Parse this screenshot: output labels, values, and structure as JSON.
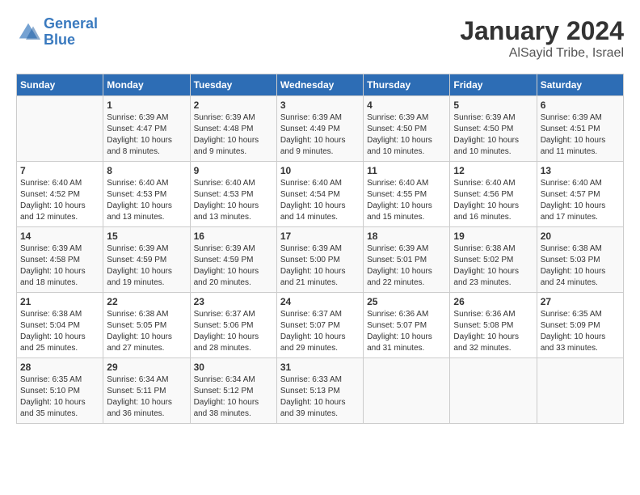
{
  "logo": {
    "line1": "General",
    "line2": "Blue"
  },
  "header": {
    "month": "January 2024",
    "location": "AlSayid Tribe, Israel"
  },
  "columns": [
    "Sunday",
    "Monday",
    "Tuesday",
    "Wednesday",
    "Thursday",
    "Friday",
    "Saturday"
  ],
  "weeks": [
    [
      {
        "day": "",
        "sunrise": "",
        "sunset": "",
        "daylight": ""
      },
      {
        "day": "1",
        "sunrise": "Sunrise: 6:39 AM",
        "sunset": "Sunset: 4:47 PM",
        "daylight": "Daylight: 10 hours and 8 minutes."
      },
      {
        "day": "2",
        "sunrise": "Sunrise: 6:39 AM",
        "sunset": "Sunset: 4:48 PM",
        "daylight": "Daylight: 10 hours and 9 minutes."
      },
      {
        "day": "3",
        "sunrise": "Sunrise: 6:39 AM",
        "sunset": "Sunset: 4:49 PM",
        "daylight": "Daylight: 10 hours and 9 minutes."
      },
      {
        "day": "4",
        "sunrise": "Sunrise: 6:39 AM",
        "sunset": "Sunset: 4:50 PM",
        "daylight": "Daylight: 10 hours and 10 minutes."
      },
      {
        "day": "5",
        "sunrise": "Sunrise: 6:39 AM",
        "sunset": "Sunset: 4:50 PM",
        "daylight": "Daylight: 10 hours and 10 minutes."
      },
      {
        "day": "6",
        "sunrise": "Sunrise: 6:39 AM",
        "sunset": "Sunset: 4:51 PM",
        "daylight": "Daylight: 10 hours and 11 minutes."
      }
    ],
    [
      {
        "day": "7",
        "sunrise": "Sunrise: 6:40 AM",
        "sunset": "Sunset: 4:52 PM",
        "daylight": "Daylight: 10 hours and 12 minutes."
      },
      {
        "day": "8",
        "sunrise": "Sunrise: 6:40 AM",
        "sunset": "Sunset: 4:53 PM",
        "daylight": "Daylight: 10 hours and 13 minutes."
      },
      {
        "day": "9",
        "sunrise": "Sunrise: 6:40 AM",
        "sunset": "Sunset: 4:53 PM",
        "daylight": "Daylight: 10 hours and 13 minutes."
      },
      {
        "day": "10",
        "sunrise": "Sunrise: 6:40 AM",
        "sunset": "Sunset: 4:54 PM",
        "daylight": "Daylight: 10 hours and 14 minutes."
      },
      {
        "day": "11",
        "sunrise": "Sunrise: 6:40 AM",
        "sunset": "Sunset: 4:55 PM",
        "daylight": "Daylight: 10 hours and 15 minutes."
      },
      {
        "day": "12",
        "sunrise": "Sunrise: 6:40 AM",
        "sunset": "Sunset: 4:56 PM",
        "daylight": "Daylight: 10 hours and 16 minutes."
      },
      {
        "day": "13",
        "sunrise": "Sunrise: 6:40 AM",
        "sunset": "Sunset: 4:57 PM",
        "daylight": "Daylight: 10 hours and 17 minutes."
      }
    ],
    [
      {
        "day": "14",
        "sunrise": "Sunrise: 6:39 AM",
        "sunset": "Sunset: 4:58 PM",
        "daylight": "Daylight: 10 hours and 18 minutes."
      },
      {
        "day": "15",
        "sunrise": "Sunrise: 6:39 AM",
        "sunset": "Sunset: 4:59 PM",
        "daylight": "Daylight: 10 hours and 19 minutes."
      },
      {
        "day": "16",
        "sunrise": "Sunrise: 6:39 AM",
        "sunset": "Sunset: 4:59 PM",
        "daylight": "Daylight: 10 hours and 20 minutes."
      },
      {
        "day": "17",
        "sunrise": "Sunrise: 6:39 AM",
        "sunset": "Sunset: 5:00 PM",
        "daylight": "Daylight: 10 hours and 21 minutes."
      },
      {
        "day": "18",
        "sunrise": "Sunrise: 6:39 AM",
        "sunset": "Sunset: 5:01 PM",
        "daylight": "Daylight: 10 hours and 22 minutes."
      },
      {
        "day": "19",
        "sunrise": "Sunrise: 6:38 AM",
        "sunset": "Sunset: 5:02 PM",
        "daylight": "Daylight: 10 hours and 23 minutes."
      },
      {
        "day": "20",
        "sunrise": "Sunrise: 6:38 AM",
        "sunset": "Sunset: 5:03 PM",
        "daylight": "Daylight: 10 hours and 24 minutes."
      }
    ],
    [
      {
        "day": "21",
        "sunrise": "Sunrise: 6:38 AM",
        "sunset": "Sunset: 5:04 PM",
        "daylight": "Daylight: 10 hours and 25 minutes."
      },
      {
        "day": "22",
        "sunrise": "Sunrise: 6:38 AM",
        "sunset": "Sunset: 5:05 PM",
        "daylight": "Daylight: 10 hours and 27 minutes."
      },
      {
        "day": "23",
        "sunrise": "Sunrise: 6:37 AM",
        "sunset": "Sunset: 5:06 PM",
        "daylight": "Daylight: 10 hours and 28 minutes."
      },
      {
        "day": "24",
        "sunrise": "Sunrise: 6:37 AM",
        "sunset": "Sunset: 5:07 PM",
        "daylight": "Daylight: 10 hours and 29 minutes."
      },
      {
        "day": "25",
        "sunrise": "Sunrise: 6:36 AM",
        "sunset": "Sunset: 5:07 PM",
        "daylight": "Daylight: 10 hours and 31 minutes."
      },
      {
        "day": "26",
        "sunrise": "Sunrise: 6:36 AM",
        "sunset": "Sunset: 5:08 PM",
        "daylight": "Daylight: 10 hours and 32 minutes."
      },
      {
        "day": "27",
        "sunrise": "Sunrise: 6:35 AM",
        "sunset": "Sunset: 5:09 PM",
        "daylight": "Daylight: 10 hours and 33 minutes."
      }
    ],
    [
      {
        "day": "28",
        "sunrise": "Sunrise: 6:35 AM",
        "sunset": "Sunset: 5:10 PM",
        "daylight": "Daylight: 10 hours and 35 minutes."
      },
      {
        "day": "29",
        "sunrise": "Sunrise: 6:34 AM",
        "sunset": "Sunset: 5:11 PM",
        "daylight": "Daylight: 10 hours and 36 minutes."
      },
      {
        "day": "30",
        "sunrise": "Sunrise: 6:34 AM",
        "sunset": "Sunset: 5:12 PM",
        "daylight": "Daylight: 10 hours and 38 minutes."
      },
      {
        "day": "31",
        "sunrise": "Sunrise: 6:33 AM",
        "sunset": "Sunset: 5:13 PM",
        "daylight": "Daylight: 10 hours and 39 minutes."
      },
      {
        "day": "",
        "sunrise": "",
        "sunset": "",
        "daylight": ""
      },
      {
        "day": "",
        "sunrise": "",
        "sunset": "",
        "daylight": ""
      },
      {
        "day": "",
        "sunrise": "",
        "sunset": "",
        "daylight": ""
      }
    ]
  ]
}
